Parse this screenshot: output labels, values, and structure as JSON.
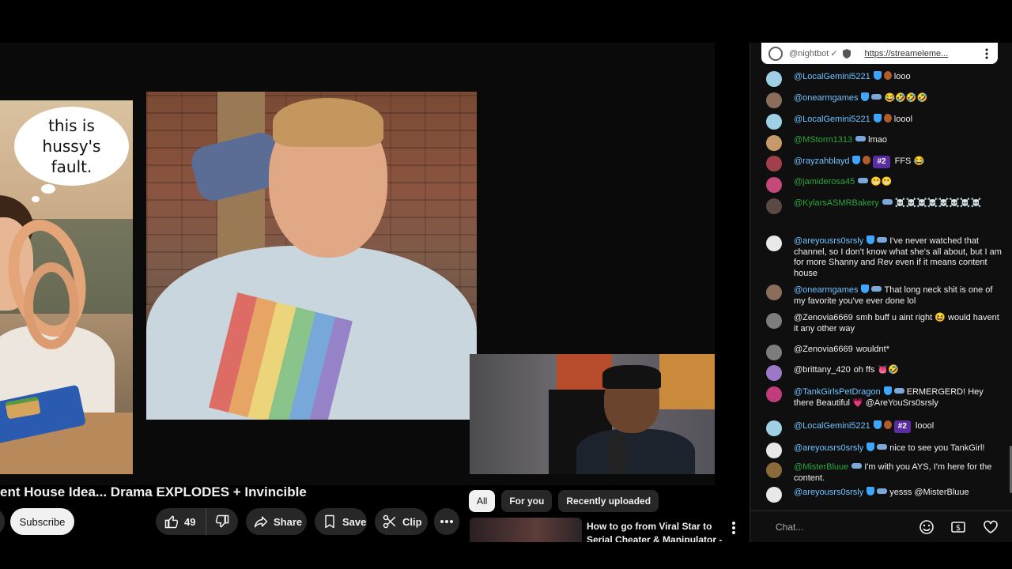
{
  "video": {
    "title": "ent House Idea... Drama EXPLODES + Invincible",
    "thumbnail_caption": "this is hussy's fault.",
    "subscribe_label": "Subscribe",
    "like_count": "49",
    "share_label": "Share",
    "save_label": "Save",
    "clip_label": "Clip"
  },
  "recommendations": {
    "chips": [
      "All",
      "For you",
      "Recently uploaded"
    ],
    "active_chip": "All",
    "first_title": "How to go from Viral Star to Serial Cheater & Manipulator - ..."
  },
  "chat": {
    "pinned": {
      "author": "@nightbot",
      "check": "✓",
      "link": "https://streameleme..."
    },
    "placeholder": "Chat...",
    "messages": [
      {
        "author": "@LocalGemini5221",
        "text": "looo",
        "avatar_color": "#9fd0e6"
      },
      {
        "author": "@onearmgames",
        "text": "😂🤣🤣🤣",
        "avatar_color": "#8a6d5a"
      },
      {
        "author": "@LocalGemini5221",
        "text": "loool",
        "avatar_color": "#9fd0e6"
      },
      {
        "author": "@MStorm1313",
        "text": "lmao",
        "avatar_color": "#c79a6b",
        "green": true
      },
      {
        "author": "@rayzahblayd",
        "rank": "#2",
        "text": "FFS 😂",
        "avatar_color": "#a0404a"
      },
      {
        "author": "@jamiderosa45",
        "text": "😬😬",
        "avatar_color": "#c2497a",
        "green": true
      },
      {
        "author": "@KylarsASMRBakery",
        "text": "☠️☠️☠️☠️☠️☠️☠️☠️",
        "avatar_color": "#5b4a44",
        "green": true
      },
      {
        "author": "@areyousrs0srsly",
        "text": "I've never watched that channel, so I don't know what she's all about, but I am for more Shanny and Rev even if it means content house",
        "avatar_color": "#e8e8e8"
      },
      {
        "author": "@onearmgames",
        "text": "That long neck shit is one of my favorite you've ever done lol",
        "avatar_color": "#8a6d5a"
      },
      {
        "author": "@Zenovia6669",
        "text": "smh buff u aint right 😆 would havent it any other way",
        "avatar_color": "#7d7d7d",
        "plain": true
      },
      {
        "author": "@Zenovia6669",
        "text": "wouldnt*",
        "avatar_color": "#7d7d7d",
        "plain": true
      },
      {
        "author": "@brittany_420",
        "text": "oh ffs 👅🤣",
        "avatar_color": "#9a7ac8",
        "plain": true
      },
      {
        "author": "@TankGirlsPetDragon",
        "text": "ERMERGERD! Hey there Beautiful 💗 @AreYouSrs0srsly",
        "avatar_color": "#c23b7a"
      },
      {
        "author": "@LocalGemini5221",
        "rank": "#2",
        "text": "loool",
        "avatar_color": "#9fd0e6"
      },
      {
        "author": "@areyousrs0srsly",
        "text": "nice to see you TankGirl!",
        "avatar_color": "#e8e8e8"
      },
      {
        "author": "@MisterBluue",
        "text": "I'm with you AYS, I'm here for the content.",
        "avatar_color": "#8a6a3a",
        "green": true
      },
      {
        "author": "@areyousrs0srsly",
        "text": "yesss @MisterBluue",
        "avatar_color": "#e8e8e8"
      }
    ]
  },
  "icons": {
    "like": "thumbs-up-icon",
    "dislike": "thumbs-down-icon",
    "share": "share-arrow-icon",
    "save": "bookmark-icon",
    "clip": "scissors-icon",
    "emoji": "smiley-icon",
    "super_chat": "dollar-icon",
    "heart": "heart-icon"
  }
}
